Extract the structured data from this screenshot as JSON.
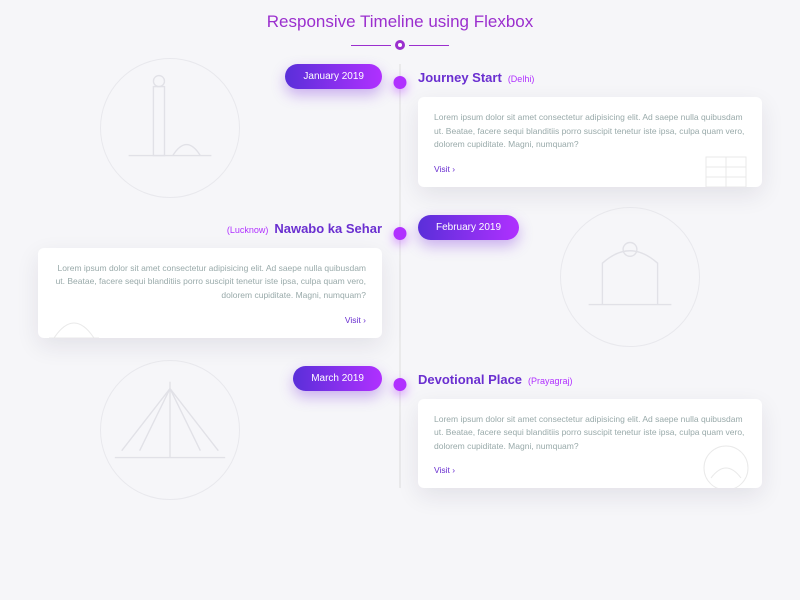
{
  "page_title": "Responsive Timeline using Flexbox",
  "items": [
    {
      "date": "January 2019",
      "title": "Journey Start",
      "location": "(Delhi)",
      "desc": "Lorem ipsum dolor sit amet consectetur adipisicing elit. Ad saepe nulla quibusdam ut. Beatae, facere sequi blanditiis porro suscipit tenetur iste ipsa, culpa quam vero, dolorem cupiditate. Magni, numquam?",
      "visit": "Visit ›",
      "side": "right"
    },
    {
      "date": "February 2019",
      "title": "Nawabo ka Sehar",
      "location": "(Lucknow)",
      "desc": "Lorem ipsum dolor sit amet consectetur adipisicing elit. Ad saepe nulla quibusdam ut. Beatae, facere sequi blanditiis porro suscipit tenetur iste ipsa, culpa quam vero, dolorem cupiditate. Magni, numquam?",
      "visit": "Visit ›",
      "side": "left"
    },
    {
      "date": "March 2019",
      "title": "Devotional Place",
      "location": "(Prayagraj)",
      "desc": "Lorem ipsum dolor sit amet consectetur adipisicing elit. Ad saepe nulla quibusdam ut. Beatae, facere sequi blanditiis porro suscipit tenetur iste ipsa, culpa quam vero, dolorem cupiditate. Magni, numquam?",
      "visit": "Visit ›",
      "side": "right"
    }
  ]
}
